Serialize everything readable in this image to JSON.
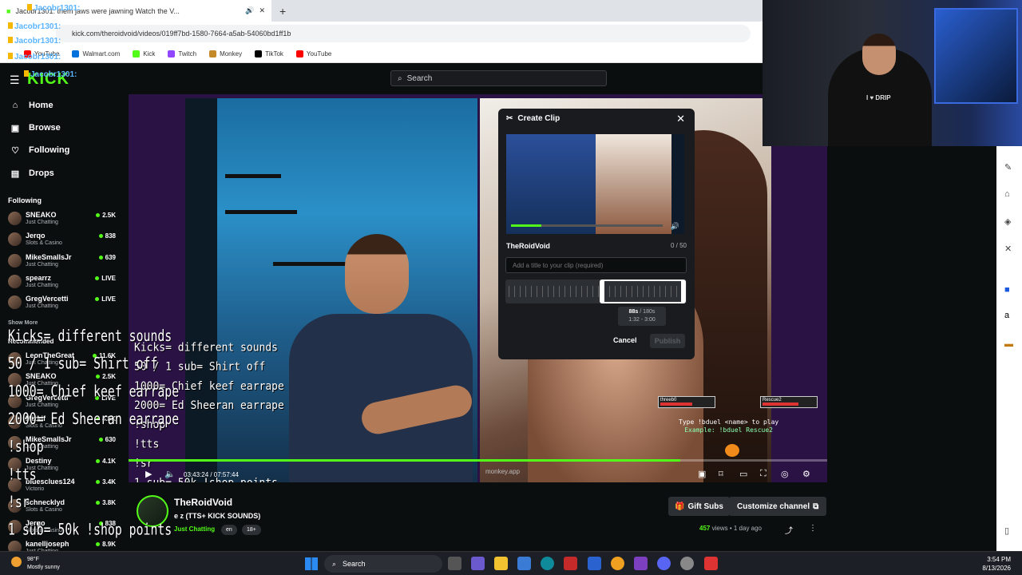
{
  "browser": {
    "tab_title": "Jacobr1301: them jaws were jawning Watch the V...",
    "new_tab": "+",
    "address": "kick.com/theroidvoid/videos/019ff7bd-1580-7664-a5ab-54060bd1ff1b",
    "bookmarks": [
      "YouTube",
      "Walmart.com",
      "Kick",
      "Twitch",
      "Monkey",
      "TikTok",
      "YouTube"
    ]
  },
  "chat_spam": {
    "user": "Jacobr1301:"
  },
  "header": {
    "logo": "KICK",
    "search_placeholder": "Search"
  },
  "sidebar": {
    "nav": [
      {
        "label": "Home",
        "icon": "home-icon"
      },
      {
        "label": "Browse",
        "icon": "browse-icon"
      },
      {
        "label": "Following",
        "icon": "heart-icon"
      },
      {
        "label": "Drops",
        "icon": "drops-icon"
      }
    ],
    "following_title": "Following",
    "following": [
      {
        "name": "SNEAKO",
        "category": "Just Chatting",
        "viewers": "2.5K"
      },
      {
        "name": "Jerqo",
        "category": "Slots & Casino",
        "viewers": "838"
      },
      {
        "name": "MikeSmallsJr",
        "category": "Just Chatting",
        "viewers": "639"
      },
      {
        "name": "spearrz",
        "category": "Just Chatting",
        "viewers": "LIVE"
      },
      {
        "name": "GregVercetti",
        "category": "Just Chatting",
        "viewers": "LIVE"
      }
    ],
    "show_more": "Show More",
    "recommended_title": "Recommended",
    "recommended": [
      {
        "name": "LeonTheGreat",
        "category": "Just Chatting",
        "viewers": "11.6K"
      },
      {
        "name": "SNEAKO",
        "category": "Just Chatting",
        "viewers": "2.5K"
      },
      {
        "name": "GregVercetti",
        "category": "Just Chatting",
        "viewers": "LIVE"
      },
      {
        "name": "Mizkif",
        "category": "Slots & Casino",
        "viewers": "4.8K"
      },
      {
        "name": "MikeSmallsJr",
        "category": "Just Chatting",
        "viewers": "630"
      },
      {
        "name": "Destiny",
        "category": "Just Chatting",
        "viewers": "4.1K"
      },
      {
        "name": "bluesclues124",
        "category": "Victorio",
        "viewers": "3.4K"
      },
      {
        "name": "schnecklyd",
        "category": "Slots & Casino",
        "viewers": "3.8K"
      },
      {
        "name": "Jerqo",
        "category": "Slots & Casino",
        "viewers": "838"
      },
      {
        "name": "kanelljoseph",
        "category": "Just Chatting",
        "viewers": "8.9K"
      }
    ]
  },
  "overlay": {
    "lines": [
      "Kicks= different sounds",
      "50 / 1 sub= Shirt off",
      "1000= Chief keef earrape",
      "2000= Ed Sheeran earrape",
      "!shop",
      "!tts",
      "!sr",
      "1 sub= 50k !shop points"
    ]
  },
  "duel": {
    "line1": "Type !bduel <name> to play",
    "line2": "Example: !bduel Rescue2",
    "player1": "threeb0",
    "player2": "Rescue2"
  },
  "player": {
    "timecode": "03:43:24 / 07:57:44",
    "watermark": "monkey.app",
    "progress": 0.79
  },
  "clip": {
    "title": "Create Clip",
    "owner": "TheRoidVoid",
    "char_count": "0 / 50",
    "title_placeholder": "Add a title to your clip (required)",
    "duration": "88s",
    "max": "/ 180s",
    "range": "1:32 - 3:00",
    "cancel": "Cancel",
    "publish": "Publish"
  },
  "webcam": {
    "shirt": "I ♥ DRIP"
  },
  "channel": {
    "name": "TheRoidVoid",
    "stream_title": "e z  (TTS+ KICK SOUNDS)",
    "category": "Just Chatting",
    "tags": [
      "en",
      "18+"
    ],
    "gift_subs": "Gift Subs",
    "customize": "Customize channel",
    "views_count": "457",
    "views_label": "views",
    "ago": "• 1 day ago"
  },
  "taskbar": {
    "temp": "98°F",
    "weather": "Mostly sunny",
    "search": "Search",
    "time": "3:54 PM",
    "date": "8/13/2026"
  },
  "colors": {
    "kick_green": "#53fc18",
    "background": "#0b0e0f"
  }
}
